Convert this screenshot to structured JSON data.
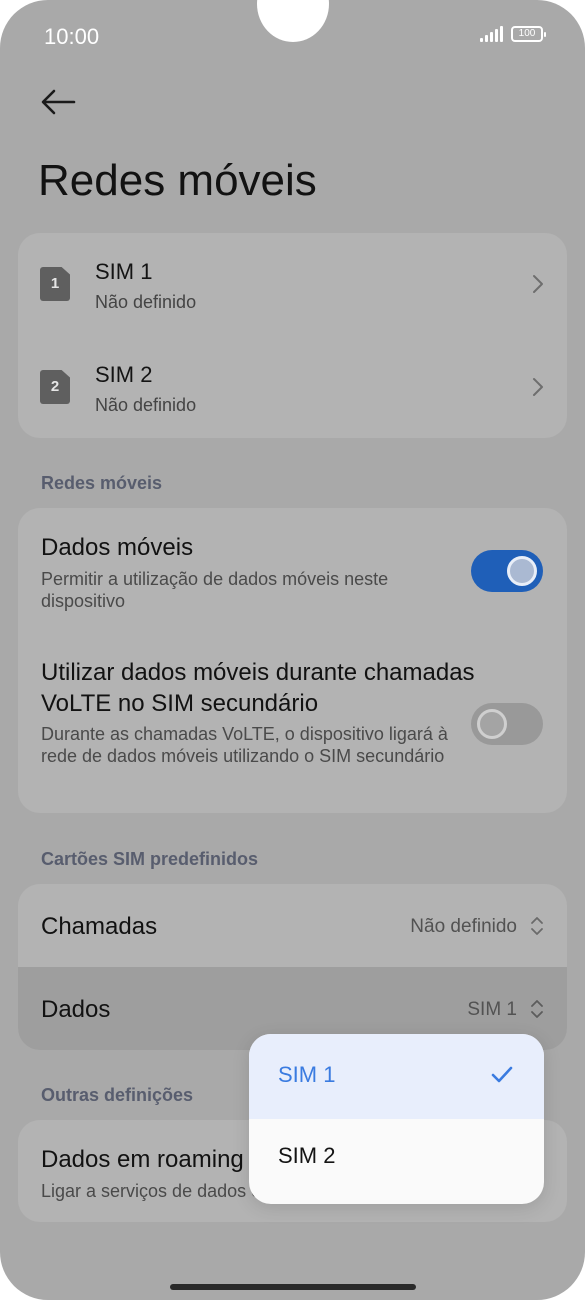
{
  "status": {
    "time": "10:00",
    "battery": "100"
  },
  "page": {
    "title": "Redes móveis"
  },
  "sims": [
    {
      "badge": "1",
      "name": "SIM 1",
      "status": "Não definido"
    },
    {
      "badge": "2",
      "name": "SIM 2",
      "status": "Não definido"
    }
  ],
  "mobile_networks": {
    "section_label": "Redes móveis",
    "mobile_data": {
      "title": "Dados móveis",
      "description": "Permitir a utilização de dados móveis neste dispositivo",
      "enabled": true
    },
    "volte_data": {
      "title": "Utilizar dados móveis durante chamadas VoLTE no SIM secundário",
      "description": "Durante as chamadas VoLTE, o dispositivo ligará à rede de dados móveis utilizando o SIM secundário",
      "enabled": false
    }
  },
  "default_sims": {
    "section_label": "Cartões SIM predefinidos",
    "calls": {
      "label": "Chamadas",
      "value": "Não definido"
    },
    "data": {
      "label": "Dados",
      "value": "SIM 1"
    }
  },
  "other_settings": {
    "section_label": "Outras definições",
    "roaming": {
      "title": "Dados em roaming",
      "description": "Ligar a serviços de dados em roaming"
    }
  },
  "popup": {
    "options": [
      {
        "label": "SIM 1",
        "selected": true
      },
      {
        "label": "SIM 2",
        "selected": false
      }
    ]
  },
  "colors": {
    "accent": "#1f5fb8",
    "selected_text": "#3a7be0",
    "background": "#a9a9a9",
    "card": "#b3b3b3"
  },
  "icons": {
    "back": "arrow-left-icon",
    "chevron": "chevron-right-icon",
    "updown": "chevron-up-down-icon",
    "check": "check-icon"
  }
}
